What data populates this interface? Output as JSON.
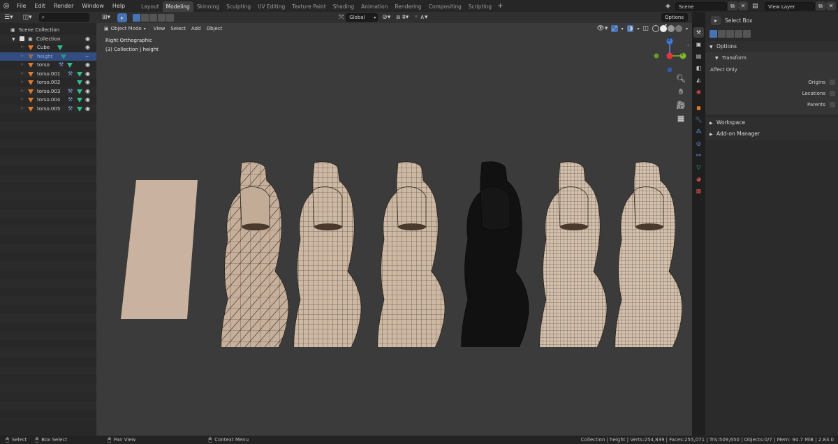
{
  "topbar": {
    "menus": [
      "File",
      "Edit",
      "Render",
      "Window",
      "Help"
    ],
    "workspace_tabs": [
      "Layout",
      "Modeling",
      "Skinning",
      "Sculpting",
      "UV Editing",
      "Texture Paint",
      "Shading",
      "Animation",
      "Rendering",
      "Compositing",
      "Scripting"
    ],
    "active_tab": "Modeling",
    "scene_label": "Scene",
    "view_layer_label": "View Layer"
  },
  "outliner": {
    "scene_collection": "Scene Collection",
    "collection": "Collection",
    "items": [
      {
        "name": "Cube",
        "selected": false
      },
      {
        "name": "height",
        "selected": true
      },
      {
        "name": "torso",
        "selected": false
      },
      {
        "name": "torso.001",
        "selected": false
      },
      {
        "name": "torso.002",
        "selected": false
      },
      {
        "name": "torso.003",
        "selected": false
      },
      {
        "name": "torso.004",
        "selected": false
      },
      {
        "name": "torso.005",
        "selected": false
      }
    ]
  },
  "viewport": {
    "transform_orientation": "Global",
    "options_label": "Options",
    "mode": "Object Mode",
    "menus": [
      "View",
      "Select",
      "Add",
      "Object"
    ],
    "view_name": "Right Orthographic",
    "collection_info": "(3) Collection | height",
    "gizmo_z": "Z",
    "gizmo_y": "Y"
  },
  "properties": {
    "tool_name": "Select Box",
    "options_label": "Options",
    "transform_label": "Transform",
    "affect_only": "Affect Only",
    "checks": [
      "Origins",
      "Locations",
      "Parents"
    ],
    "workspace_label": "Workspace",
    "addon_label": "Add-on Manager"
  },
  "statusbar": {
    "select": "Select",
    "box_select": "Box Select",
    "pan_view": "Pan View",
    "context_menu": "Context Menu",
    "stats": "Collection | height | Verts:254,839 | Faces:255,071 | Tris:509,650 | Objects:0/7 | Mem: 94.7 MiB | 2.83.0"
  },
  "colors": {
    "accent": "#4772b3",
    "selected_row": "#334d80",
    "object_icon": "#e07b2c",
    "mesh_icon": "#2fbf8a",
    "mesh_surface": "#cdb8a4",
    "viewport_bg": "#3b3b3b"
  }
}
